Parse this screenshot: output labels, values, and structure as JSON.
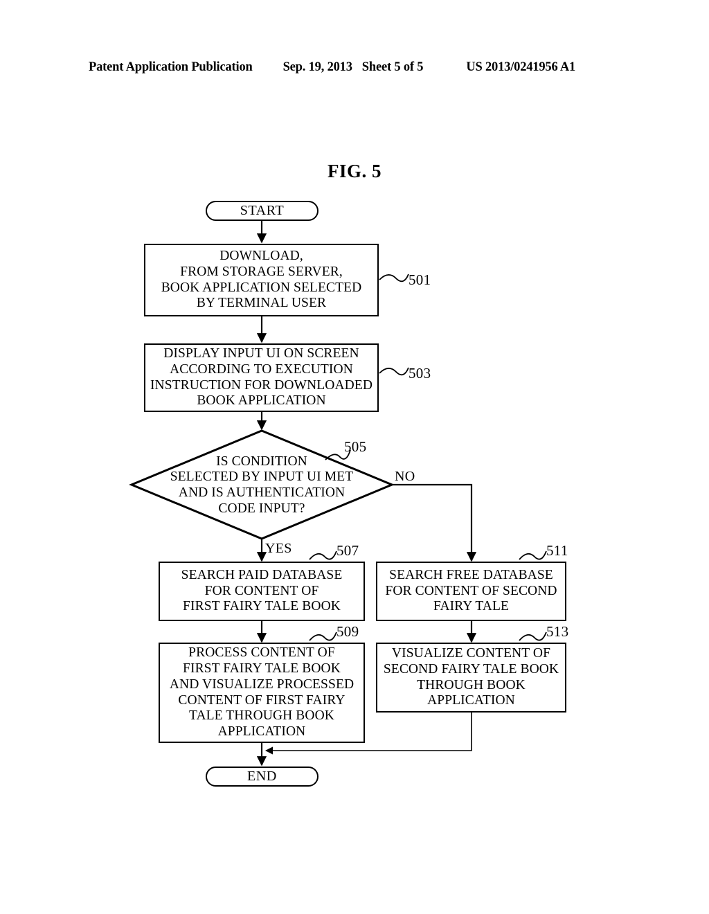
{
  "header": {
    "publication": "Patent Application Publication",
    "date": "Sep. 19, 2013",
    "sheet": "Sheet 5 of 5",
    "patent_number": "US 2013/0241956 A1"
  },
  "figure": {
    "title": "FIG. 5"
  },
  "flowchart": {
    "start": {
      "label": "START"
    },
    "end": {
      "label": "END"
    },
    "nodes": [
      {
        "ref": "501",
        "text": "DOWNLOAD,\nFROM STORAGE SERVER,\nBOOK APPLICATION SELECTED\nBY TERMINAL USER"
      },
      {
        "ref": "503",
        "text": "DISPLAY INPUT UI ON SCREEN\nACCORDING TO EXECUTION\nINSTRUCTION FOR DOWNLOADED\nBOOK APPLICATION"
      },
      {
        "ref": "505",
        "text": "IS CONDITION\nSELECTED BY INPUT UI MET\nAND IS AUTHENTICATION\nCODE INPUT?"
      },
      {
        "ref": "507",
        "text": "SEARCH PAID DATABASE\nFOR CONTENT OF\nFIRST FAIRY TALE BOOK"
      },
      {
        "ref": "509",
        "text": "PROCESS CONTENT OF\nFIRST FAIRY TALE BOOK\nAND VISUALIZE PROCESSED\nCONTENT OF FIRST FAIRY\nTALE THROUGH BOOK\nAPPLICATION"
      },
      {
        "ref": "511",
        "text": "SEARCH FREE DATABASE\nFOR CONTENT OF SECOND\nFAIRY TALE"
      },
      {
        "ref": "513",
        "text": "VISUALIZE CONTENT OF\nSECOND FAIRY TALE BOOK\nTHROUGH BOOK\nAPPLICATION"
      }
    ],
    "branches": {
      "yes": "YES",
      "no": "NO"
    },
    "refs": {
      "r501": "501",
      "r503": "503",
      "r505": "505",
      "r507": "507",
      "r509": "509",
      "r511": "511",
      "r513": "513"
    }
  },
  "colors": {
    "ink": "#000000",
    "paper": "#ffffff"
  }
}
